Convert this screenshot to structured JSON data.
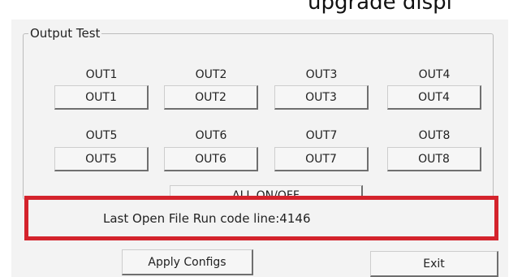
{
  "top_text": "upgrade  displ",
  "output_test": {
    "legend": "Output Test",
    "outputs": [
      {
        "label": "OUT1",
        "button": "OUT1"
      },
      {
        "label": "OUT2",
        "button": "OUT2"
      },
      {
        "label": "OUT3",
        "button": "OUT3"
      },
      {
        "label": "OUT4",
        "button": "OUT4"
      },
      {
        "label": "OUT5",
        "button": "OUT5"
      },
      {
        "label": "OUT6",
        "button": "OUT6"
      },
      {
        "label": "OUT7",
        "button": "OUT7"
      },
      {
        "label": "OUT8",
        "button": "OUT8"
      }
    ],
    "all_toggle": "ALL ON/OFF"
  },
  "status": {
    "text": "Last Open File Run code line:4146",
    "highlight_color": "#d4232c"
  },
  "footer": {
    "apply_label": "Apply Configs",
    "exit_label": "Exit"
  }
}
